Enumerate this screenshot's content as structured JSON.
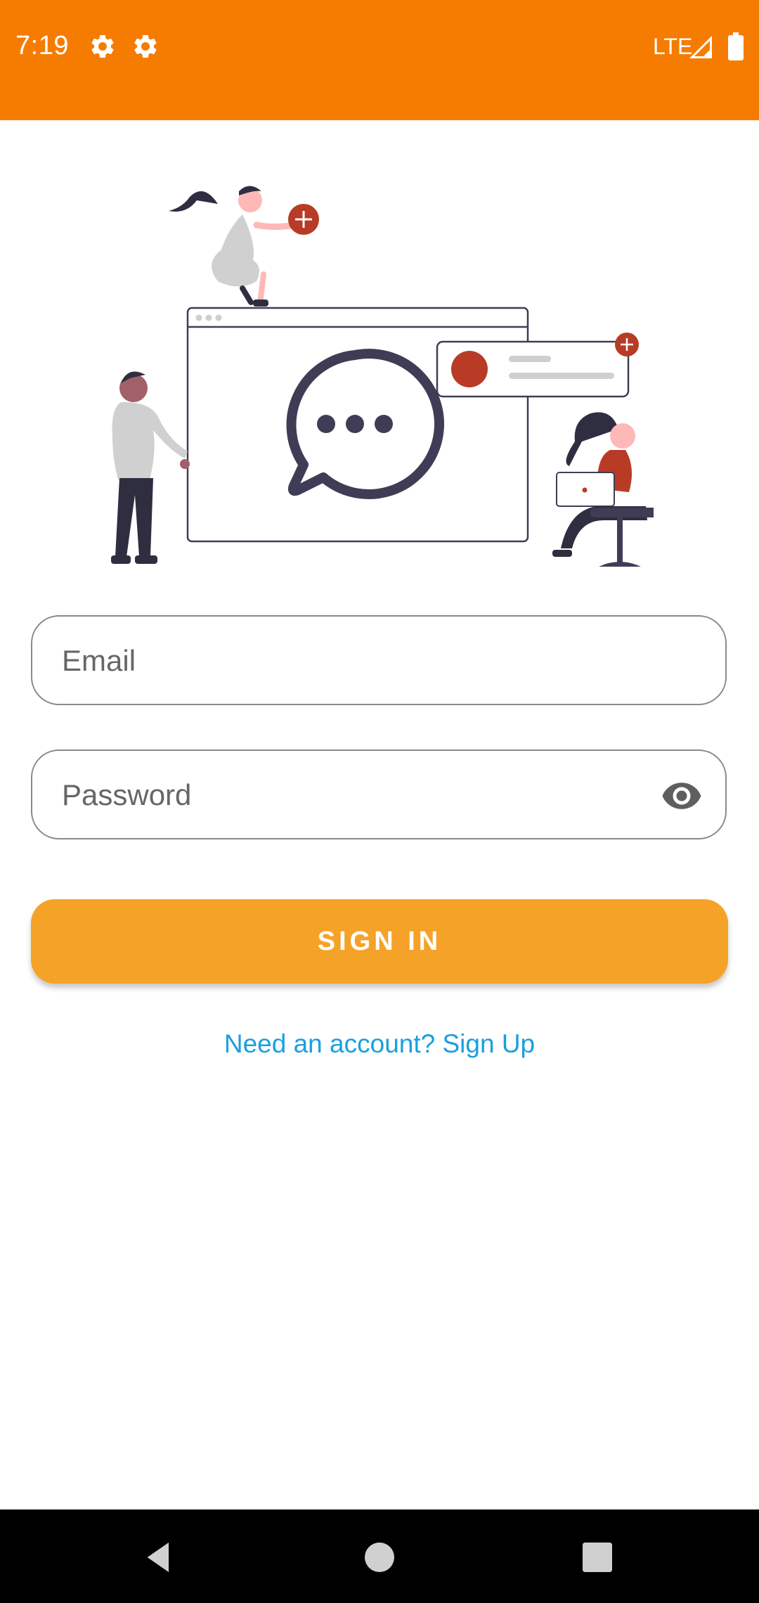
{
  "status_bar": {
    "time": "7:19",
    "network": "LTE",
    "icons": [
      "settings-gear-icon",
      "settings-gear-icon",
      "signal-icon",
      "battery-icon"
    ],
    "background": "#f57c00"
  },
  "illustration": {
    "name": "chat-team-illustration",
    "accent": "#b83b26"
  },
  "form": {
    "email_placeholder": "Email",
    "password_placeholder": "Password",
    "password_toggle_icon": "eye-icon",
    "signin_label": "SIGN IN",
    "signup_link": "Need an account? Sign Up"
  },
  "colors": {
    "button": "#f5a228",
    "link": "#1a9fe0",
    "field_border": "#8a8a8a"
  },
  "nav_bar": {
    "icons": [
      "back-icon",
      "home-icon",
      "recents-icon"
    ]
  }
}
